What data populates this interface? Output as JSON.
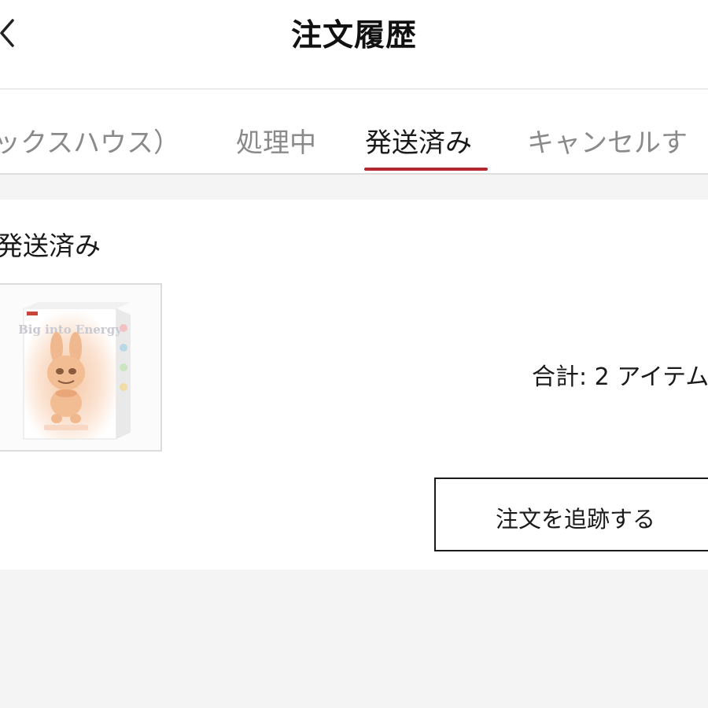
{
  "header": {
    "title": "注文履歴",
    "back_icon": "chevron-left-icon"
  },
  "tabs": [
    {
      "label": "ックスハウス）",
      "active": false
    },
    {
      "label": "処理中",
      "active": false
    },
    {
      "label": "発送済み",
      "active": true
    },
    {
      "label": "キャンセルす",
      "active": false
    }
  ],
  "colors": {
    "accent": "#b3272d",
    "background": "#f4f4f4"
  },
  "order": {
    "status": "発送済み",
    "total": "合計: 2 アイテム",
    "track_label": "注文を追跡する",
    "product_image_text": "Big into Energy"
  }
}
